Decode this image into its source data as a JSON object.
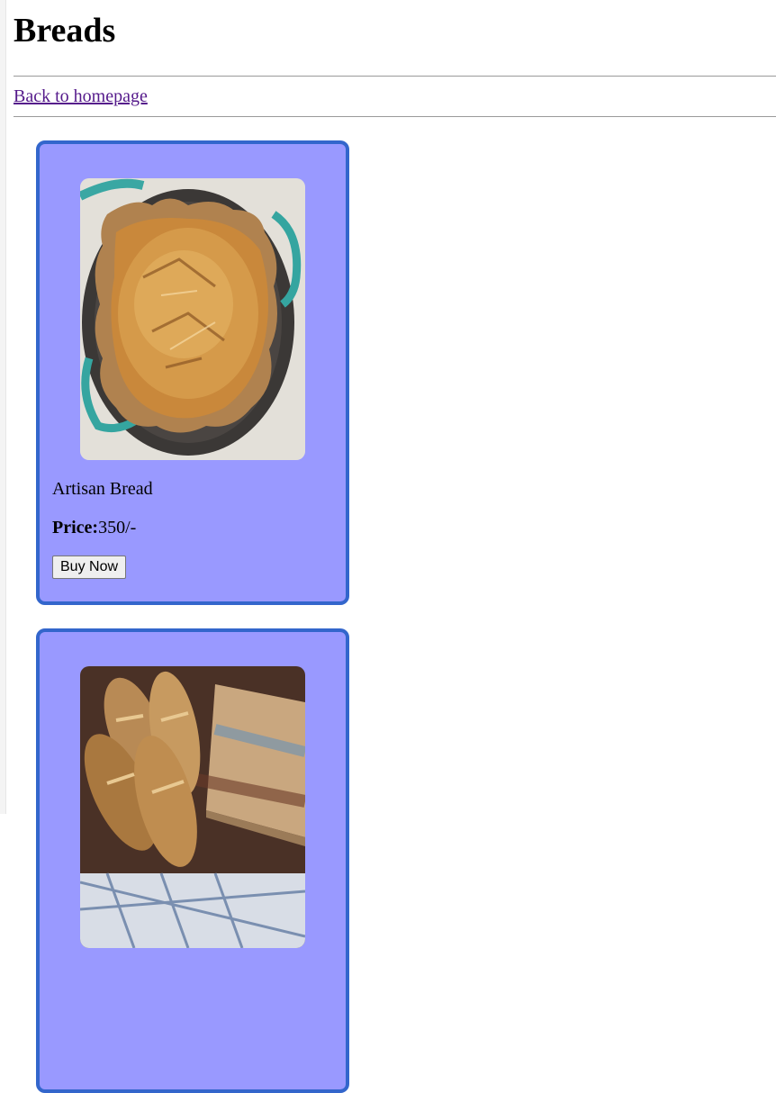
{
  "page": {
    "title": "Breads",
    "back_link": "Back to homepage"
  },
  "products": [
    {
      "name": "Artisan Bread",
      "price_label": "Price:",
      "price_value": "350/-",
      "button_label": "Buy Now",
      "image": "artisan bread in dutch oven"
    },
    {
      "name": "",
      "image": "baguette loaves on cutting board"
    }
  ],
  "colors": {
    "card_bg": "#9999ff",
    "card_border": "#3366cc",
    "link": "#551a8b"
  }
}
